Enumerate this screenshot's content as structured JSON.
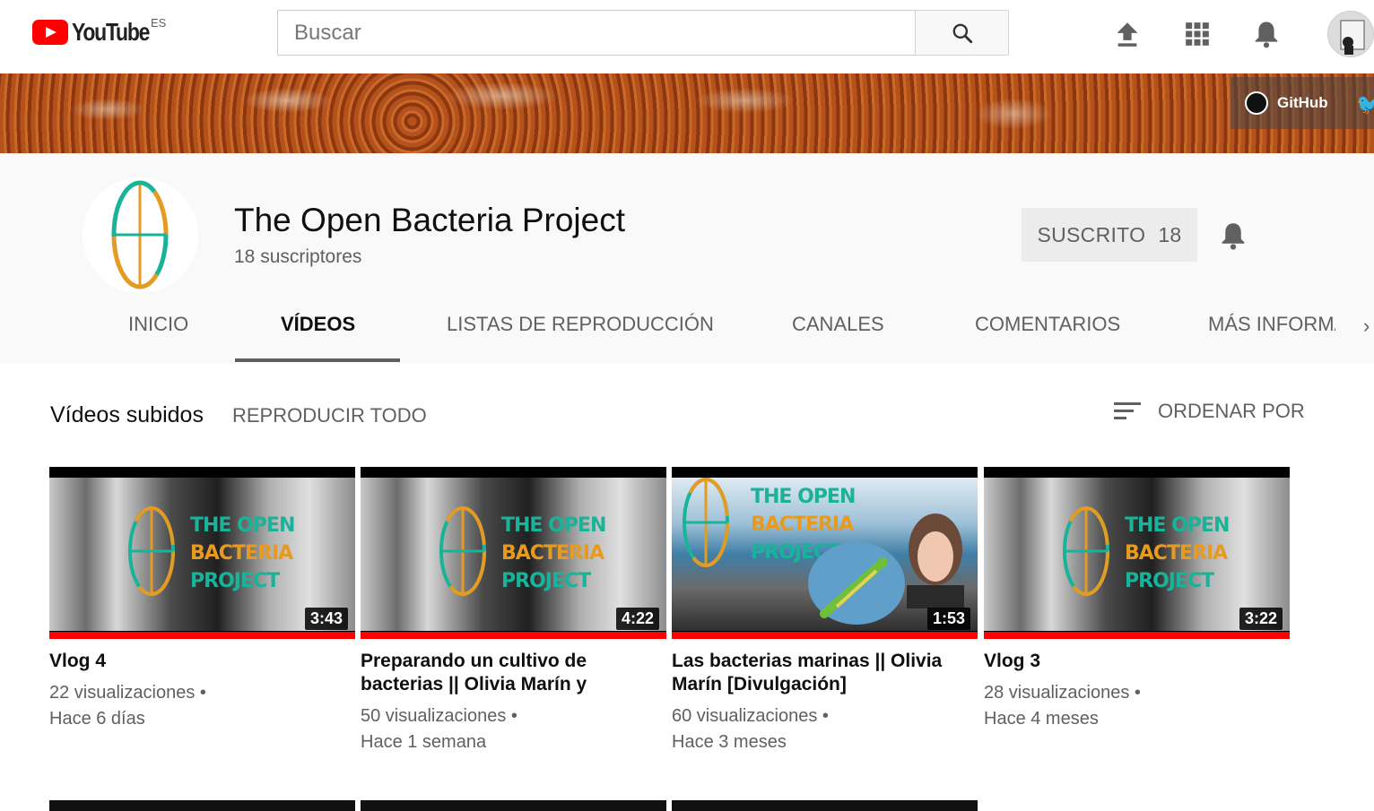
{
  "masthead": {
    "logo_text": "YouTube",
    "country": "ES",
    "search_placeholder": "Buscar"
  },
  "banner": {
    "social_label": "GitHub"
  },
  "channel": {
    "title": "The Open Bacteria Project",
    "subscribers": "18 suscriptores",
    "subscribe_label": "SUSCRITO",
    "subscribe_count": "18"
  },
  "tabs": [
    {
      "label": "INICIO"
    },
    {
      "label": "VÍDEOS"
    },
    {
      "label": "LISTAS DE REPRODUCCIÓN"
    },
    {
      "label": "CANALES"
    },
    {
      "label": "COMENTARIOS"
    },
    {
      "label": "MÁS INFORMACIÓN"
    }
  ],
  "section": {
    "title": "Vídeos subidos",
    "play_all": "REPRODUCIR TODO",
    "sort_label": "ORDENAR POR"
  },
  "videos": [
    {
      "title": "Vlog 4",
      "views": "22 visualizaciones",
      "age": "Hace 6 días",
      "duration": "3:43",
      "thumb_text": [
        "THE OPEN",
        "BACTERIA",
        "PROJECT"
      ]
    },
    {
      "title": "Preparando un cultivo de bacterias || Olivia Marín y",
      "views": "50 visualizaciones",
      "age": "Hace 1 semana",
      "duration": "4:22",
      "thumb_text": [
        "THE OPEN",
        "BACTERIA",
        "PROJECT"
      ]
    },
    {
      "title": "Las bacterias marinas || Olivia Marín [Divulgación]",
      "views": "60 visualizaciones",
      "age": "Hace 3 meses",
      "duration": "1:53",
      "thumb_text": [
        "THE OPEN",
        "BACTERIA",
        "PROJECT"
      ]
    },
    {
      "title": "Vlog 3",
      "views": "28 visualizaciones",
      "age": "Hace 4 meses",
      "duration": "3:22",
      "thumb_text": [
        "THE OPEN",
        "BACTERIA",
        "PROJECT"
      ]
    }
  ],
  "colors": {
    "brand_red": "#ff0000",
    "logo_teal": "#19b39a",
    "logo_orange": "#e59b21"
  }
}
